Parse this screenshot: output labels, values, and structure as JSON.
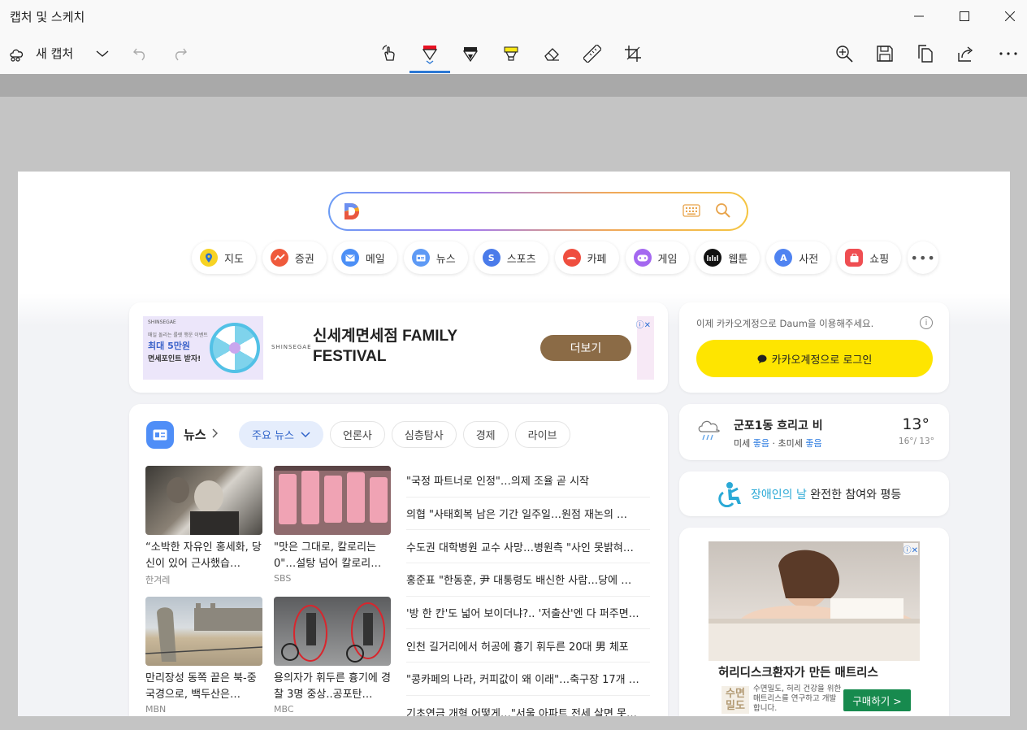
{
  "app": {
    "title": "캡처 및 스케치",
    "new_snip_label": "새 캡처"
  },
  "colors": {
    "accent": "#2b78d4",
    "kakao_yellow": "#fee500",
    "pen_red": "#e81123",
    "highlighter_yellow": "#f9e816",
    "news_active": "#2f63c9"
  },
  "toolbar_icons": [
    "touch-writing-icon",
    "ballpoint-pen-icon",
    "pencil-icon",
    "highlighter-icon",
    "eraser-icon",
    "ruler-icon",
    "crop-icon",
    "zoom-in-icon",
    "save-icon",
    "copy-icon",
    "share-icon",
    "more-icon"
  ],
  "search": {
    "placeholder": ""
  },
  "services": [
    {
      "label": "지도",
      "color": "#f7d324",
      "icon": "map-pin-icon"
    },
    {
      "label": "증권",
      "color": "#ef5a3c",
      "icon": "stock-chart-icon"
    },
    {
      "label": "메일",
      "color": "#4c8ff6",
      "icon": "mail-icon"
    },
    {
      "label": "뉴스",
      "color": "#5e9af5",
      "icon": "news-icon"
    },
    {
      "label": "스포츠",
      "color": "#4a7bea",
      "icon": "sports-icon"
    },
    {
      "label": "카페",
      "color": "#ef4e3f",
      "icon": "cafe-icon"
    },
    {
      "label": "게임",
      "color": "#a468f0",
      "icon": "game-icon"
    },
    {
      "label": "웹툰",
      "color": "#111111",
      "icon": "webtoon-icon"
    },
    {
      "label": "사전",
      "color": "#4f83f1",
      "icon": "dictionary-icon"
    },
    {
      "label": "쇼핑",
      "color": "#ef4e52",
      "icon": "shopping-icon"
    }
  ],
  "ad": {
    "brand_small": "SHINSEGAE",
    "promo_small": "매일 돌리는 룰렛 행운 이벤트",
    "promo_big": "최대 5만원",
    "promo_mid": "면세포인트 받자!",
    "shinsegae": "SHINSEGAE",
    "headline": "신세계면세점 FAMILY FESTIVAL",
    "cta": "더보기"
  },
  "news": {
    "title": "뉴스",
    "tabs": [
      {
        "label": "주요 뉴스",
        "active": true
      },
      {
        "label": "언론사",
        "active": false
      },
      {
        "label": "심층탐사",
        "active": false
      },
      {
        "label": "경제",
        "active": false
      },
      {
        "label": "라이브",
        "active": false
      }
    ],
    "photo_items": [
      {
        "caption": "“소박한 자유인 홍세화, 당신이 있어 근사했습…",
        "source": "한겨레"
      },
      {
        "caption": "\"맛은 그대로, 칼로리는 0\"…설탕 넘어 칼로리…",
        "source": "SBS"
      },
      {
        "caption": "만리장성 동쪽 끝은 북-중 국경으로, 백두산은…",
        "source": "MBN"
      },
      {
        "caption": "용의자가 휘두른 흉기에 경찰 3명 중상..공포탄…",
        "source": "MBC"
      }
    ],
    "headlines": [
      "\"국정 파트너로 인정\"…의제 조율 곧 시작",
      "의협 \"사태회복 남은 기간 일주일…원점 재논의 …",
      "수도권 대학병원 교수 사망…병원측 \"사인 못밝혀…",
      "홍준표 \"한동훈, 尹 대통령도 배신한 사람…당에 …",
      "'방 한 칸'도 넓어 보이더냐?.. '저출산'엔 다 퍼주면…",
      "인천 길거리에서 허공에 흉기 휘두른 20대 男 체포",
      "\"콩카페의 나라, 커피값이 왜 이래\"…축구장 17개 …",
      "기초연금 개혁 어떻게…\"서울 아파트 전세 살면 못…"
    ]
  },
  "login": {
    "note": "이제 카카오계정으로 Daum을 이용해주세요.",
    "button": "카카오계정으로 로그인"
  },
  "weather": {
    "location_condition": "군포1동 흐리고 비",
    "fine_dust_label": "미세",
    "fine_dust_value": "좋음",
    "ultra_dust_label": "초미세",
    "ultra_dust_value": "좋음",
    "temp": "13°",
    "range": "16°/ 13°"
  },
  "campaign": {
    "highlight": "장애인의 날",
    "text": " 완전한 참여와 평등"
  },
  "mattress_ad": {
    "title": "허리디스크환자가 만든 매트리스",
    "logo": "수면밀도",
    "desc": "수면밀도, 허리 건강을 위한 매트리스를 연구하고 개발합니다.",
    "cta": "구매하기 >"
  }
}
